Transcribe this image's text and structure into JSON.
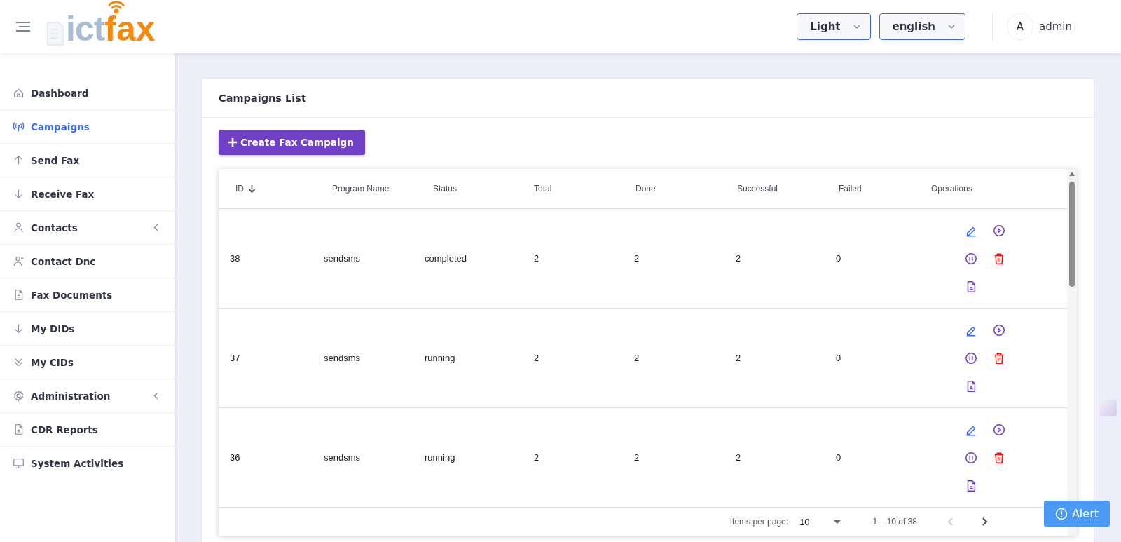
{
  "header": {
    "logo_light": "ict",
    "logo_accent": "fax",
    "theme_select": "Light",
    "language_select": "english",
    "avatar_letter": "A",
    "user_name": "admin"
  },
  "sidebar": {
    "items": [
      {
        "label": "Dashboard",
        "selected": false,
        "has_submenu": false
      },
      {
        "label": "Campaigns",
        "selected": true,
        "has_submenu": false
      },
      {
        "label": "Send Fax",
        "selected": false,
        "has_submenu": false
      },
      {
        "label": "Receive Fax",
        "selected": false,
        "has_submenu": false
      },
      {
        "label": "Contacts",
        "selected": false,
        "has_submenu": true
      },
      {
        "label": "Contact Dnc",
        "selected": false,
        "has_submenu": false
      },
      {
        "label": "Fax Documents",
        "selected": false,
        "has_submenu": false
      },
      {
        "label": "My DIDs",
        "selected": false,
        "has_submenu": false
      },
      {
        "label": "My CIDs",
        "selected": false,
        "has_submenu": false
      },
      {
        "label": "Administration",
        "selected": false,
        "has_submenu": true
      },
      {
        "label": "CDR Reports",
        "selected": false,
        "has_submenu": false
      },
      {
        "label": "System Activities",
        "selected": false,
        "has_submenu": false
      }
    ]
  },
  "card": {
    "title": "Campaigns List",
    "create_button": "Create Fax Campaign"
  },
  "table": {
    "columns": [
      "ID",
      "Program Name",
      "Status",
      "Total",
      "Done",
      "Successful",
      "Failed",
      "Operations"
    ],
    "rows": [
      {
        "id": "38",
        "program_name": "sendsms",
        "status": "completed",
        "total": "2",
        "done": "2",
        "successful": "2",
        "failed": "0"
      },
      {
        "id": "37",
        "program_name": "sendsms",
        "status": "running",
        "total": "2",
        "done": "2",
        "successful": "2",
        "failed": "0"
      },
      {
        "id": "36",
        "program_name": "sendsms",
        "status": "running",
        "total": "2",
        "done": "2",
        "successful": "2",
        "failed": "0"
      }
    ]
  },
  "pagination": {
    "items_per_page_label": "Items per page:",
    "page_size": "10",
    "range": "1 – 10 of 38"
  },
  "alert_button": "Alert"
}
